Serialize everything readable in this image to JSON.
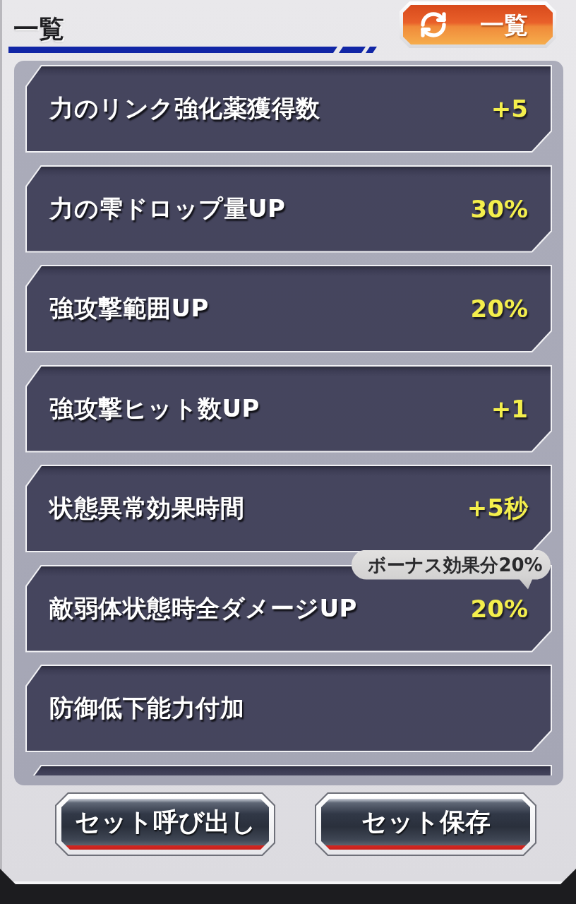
{
  "header": {
    "title": "一覧",
    "toggle_button": {
      "label": "一覧"
    }
  },
  "effects": [
    {
      "name": "力のリンク強化薬獲得数",
      "value": "+5"
    },
    {
      "name": "力の雫ドロップ量UP",
      "value": "30%"
    },
    {
      "name": "強攻撃範囲UP",
      "value": "20%"
    },
    {
      "name": "強攻撃ヒット数UP",
      "value": "+1"
    },
    {
      "name": "状態異常効果時間",
      "value": "+5秒"
    },
    {
      "name": "敵弱体状態時全ダメージUP",
      "value": "20%",
      "bonus_note": "ボーナス効果分20%"
    },
    {
      "name": "防御低下能力付加"
    }
  ],
  "buttons": [
    {
      "label": "セット呼び出し"
    },
    {
      "label": "セット保存"
    }
  ]
}
